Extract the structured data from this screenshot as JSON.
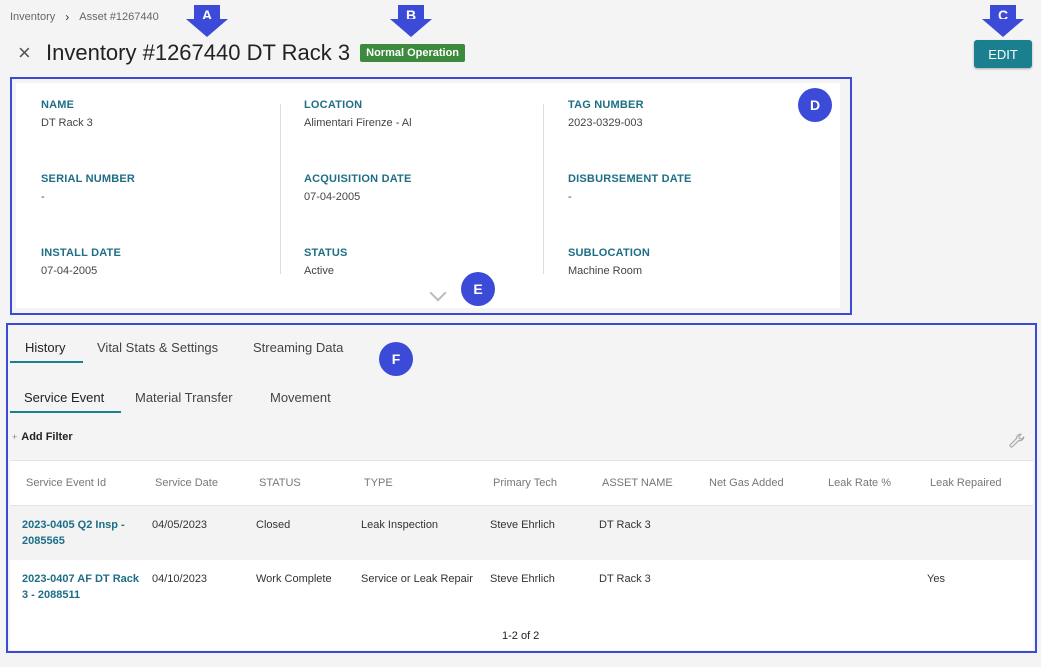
{
  "breadcrumb": {
    "root": "Inventory",
    "current": "Asset #1267440"
  },
  "header": {
    "title": "Inventory #1267440 DT Rack 3",
    "status": "Normal Operation",
    "edit_label": "EDIT"
  },
  "annotations": {
    "a": "A",
    "b": "B",
    "c": "C",
    "d": "D",
    "e": "E",
    "f": "F"
  },
  "details": {
    "name_label": "NAME",
    "name": "DT Rack 3",
    "location_label": "LOCATION",
    "location": "Alimentari Firenze - Al",
    "tag_label": "TAG NUMBER",
    "tag": "2023-0329-003",
    "serial_label": "SERIAL NUMBER",
    "serial": "-",
    "acq_label": "ACQUISITION DATE",
    "acq": "07-04-2005",
    "disb_label": "DISBURSEMENT DATE",
    "disb": "-",
    "install_label": "INSTALL DATE",
    "install": "07-04-2005",
    "status_label": "STATUS",
    "status": "Active",
    "subloc_label": "SUBLOCATION",
    "subloc": "Machine Room"
  },
  "tabs": {
    "history": "History",
    "vitals": "Vital Stats & Settings",
    "streaming": "Streaming Data"
  },
  "subtabs": {
    "service": "Service Event",
    "material": "Material Transfer",
    "movement": "Movement"
  },
  "filter": {
    "add": "Add Filter"
  },
  "table": {
    "headers": [
      "Service Event Id",
      "Service Date",
      "STATUS",
      "TYPE",
      "Primary Tech",
      "ASSET NAME",
      "Net Gas Added",
      "Leak Rate %",
      "Leak Repaired"
    ],
    "rows": [
      {
        "id": "2023-0405 Q2 Insp - 2085565",
        "date": "04/05/2023",
        "status": "Closed",
        "type": "Leak Inspection",
        "tech": "Steve Ehrlich",
        "asset": "DT Rack 3",
        "gas": "",
        "leak": "",
        "repaired": ""
      },
      {
        "id": "2023-0407 AF DT Rack 3 - 2088511",
        "date": "04/10/2023",
        "status": "Work Complete",
        "type": "Service or Leak Repair",
        "tech": "Steve Ehrlich",
        "asset": "DT Rack 3",
        "gas": "",
        "leak": "",
        "repaired": "Yes"
      }
    ]
  },
  "pager": "1-2 of 2",
  "colors": {
    "accent": "#1a7f8e",
    "status_green": "#3b8a3e",
    "annotation": "#3b4bd8"
  }
}
